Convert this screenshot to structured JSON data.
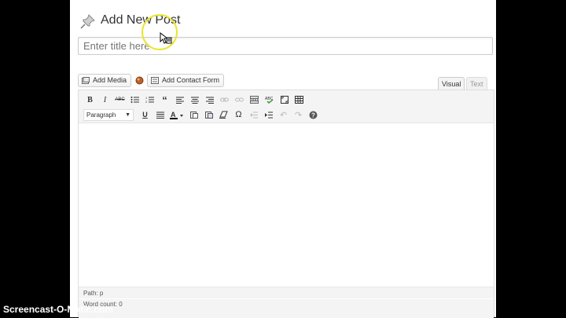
{
  "header": {
    "title": "Add New Post"
  },
  "title_field": {
    "placeholder": "Enter title here"
  },
  "media_buttons": {
    "add_media": "Add Media",
    "add_contact_form": "Add Contact Form"
  },
  "editor_tabs": {
    "visual": "Visual",
    "text": "Text",
    "active": "Visual"
  },
  "toolbar": {
    "row1": [
      "bold-icon",
      "italic-icon",
      "strikethrough-icon",
      "bullet-list-icon",
      "numbered-list-icon",
      "blockquote-icon",
      "align-left-icon",
      "align-center-icon",
      "align-right-icon",
      "link-icon",
      "unlink-icon",
      "read-more-icon",
      "spellcheck-icon",
      "fullscreen-icon",
      "kitchen-sink-icon"
    ],
    "format_select": "Paragraph",
    "row2": [
      "underline-icon",
      "justify-icon",
      "text-color-icon",
      "paste-text-icon",
      "paste-word-icon",
      "clear-formatting-icon",
      "special-char-icon",
      "outdent-icon",
      "indent-icon",
      "undo-icon",
      "redo-icon",
      "help-icon"
    ]
  },
  "status": {
    "path": "Path: p",
    "word_count": "Word count: 0"
  },
  "watermark": "Screencast-O-Matic.com",
  "colors": {
    "accent_cursor": "#e8e630",
    "spellcheck": "#3a9a3a"
  }
}
